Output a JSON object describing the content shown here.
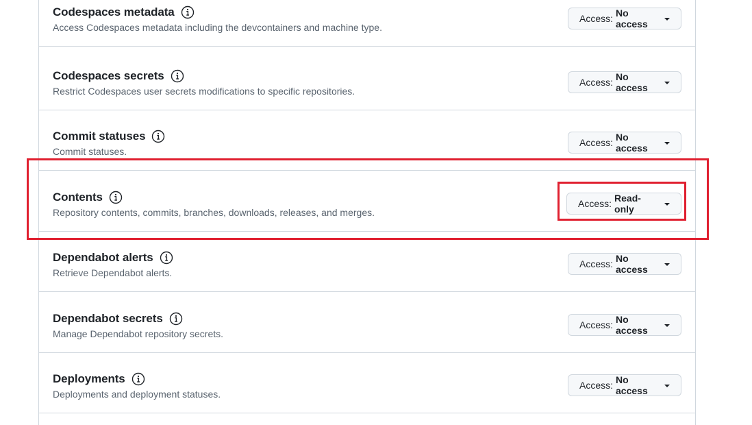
{
  "permissions": [
    {
      "title": "Codespaces metadata",
      "description": "Access Codespaces metadata including the devcontainers and machine type.",
      "access_label": "Access:",
      "access_value": "No access"
    },
    {
      "title": "Codespaces secrets",
      "description": "Restrict Codespaces user secrets modifications to specific repositories.",
      "access_label": "Access:",
      "access_value": "No access"
    },
    {
      "title": "Commit statuses",
      "description": "Commit statuses.",
      "access_label": "Access:",
      "access_value": "No access"
    },
    {
      "title": "Contents",
      "description": "Repository contents, commits, branches, downloads, releases, and merges.",
      "access_label": "Access:",
      "access_value": "Read-only"
    },
    {
      "title": "Dependabot alerts",
      "description": "Retrieve Dependabot alerts.",
      "access_label": "Access:",
      "access_value": "No access"
    },
    {
      "title": "Dependabot secrets",
      "description": "Manage Dependabot repository secrets.",
      "access_label": "Access:",
      "access_value": "No access"
    },
    {
      "title": "Deployments",
      "description": "Deployments and deployment statuses.",
      "access_label": "Access:",
      "access_value": "No access"
    }
  ],
  "colors": {
    "highlight": "#e02030",
    "border": "#d0d7de",
    "button_bg": "#f6f8fa",
    "muted_text": "#59636e"
  },
  "icons": {
    "info": "info-circle-icon",
    "dropdown": "caret-down-icon"
  }
}
